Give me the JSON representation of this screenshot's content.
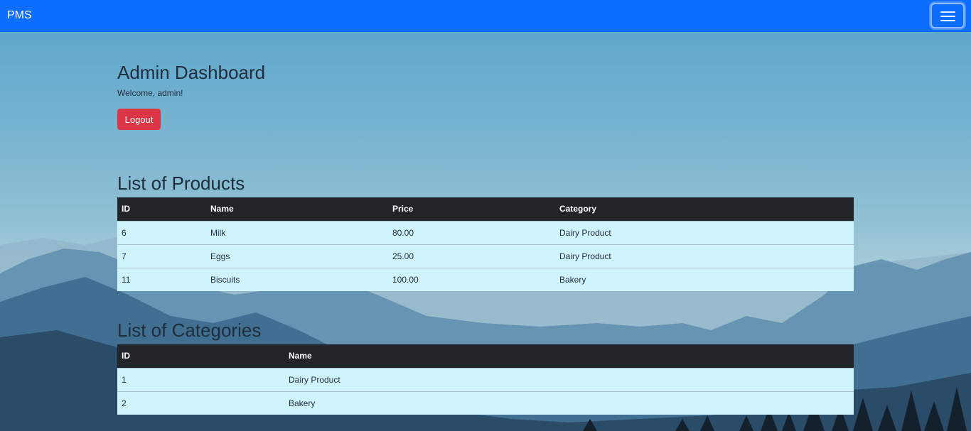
{
  "navbar": {
    "brand": "PMS",
    "toggle_icon": "menu-icon",
    "color": "#0d6efd"
  },
  "header": {
    "title": "Admin Dashboard",
    "welcome": "Welcome, admin!",
    "logout_label": "Logout"
  },
  "products": {
    "title": "List of Products",
    "columns": [
      "ID",
      "Name",
      "Price",
      "Category"
    ],
    "rows": [
      [
        "6",
        "Milk",
        "80.00",
        "Dairy Product"
      ],
      [
        "7",
        "Eggs",
        "25.00",
        "Dairy Product"
      ],
      [
        "11",
        "Biscuits",
        "100.00",
        "Bakery"
      ]
    ]
  },
  "categories": {
    "title": "List of Categories",
    "columns": [
      "ID",
      "Name"
    ],
    "rows": [
      [
        "1",
        "Dairy Product"
      ],
      [
        "2",
        "Bakery"
      ]
    ]
  },
  "colors": {
    "danger": "#dc3545",
    "table_head": "#212529",
    "table_row": "#cff4fc"
  }
}
